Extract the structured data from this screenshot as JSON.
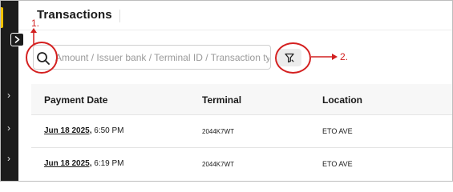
{
  "header": {
    "title": "Transactions"
  },
  "annotations": {
    "step1": "1.",
    "step2": "2.",
    "color": "#d22020"
  },
  "search": {
    "placeholder": "Amount / Issuer bank / Terminal ID / Transaction type",
    "value": ""
  },
  "icons": {
    "search": "search-icon",
    "filter": "filter-icon",
    "expand": "chevron-right-icon",
    "sidebar_nav": "chevron-right-icon"
  },
  "table": {
    "columns": [
      "Payment Date",
      "Terminal",
      "Location"
    ],
    "rows": [
      {
        "date": "Jun 18 2025,",
        "time": " 6:50 PM",
        "terminal": "2044K7WT",
        "location": "ETO AVE"
      },
      {
        "date": "Jun 18 2025,",
        "time": " 6:19 PM",
        "terminal": "2044K7WT",
        "location": "ETO AVE"
      }
    ]
  },
  "colors": {
    "sidebar": "#1c1c1c",
    "accent": "#f2c200",
    "annotation": "#d22020"
  }
}
